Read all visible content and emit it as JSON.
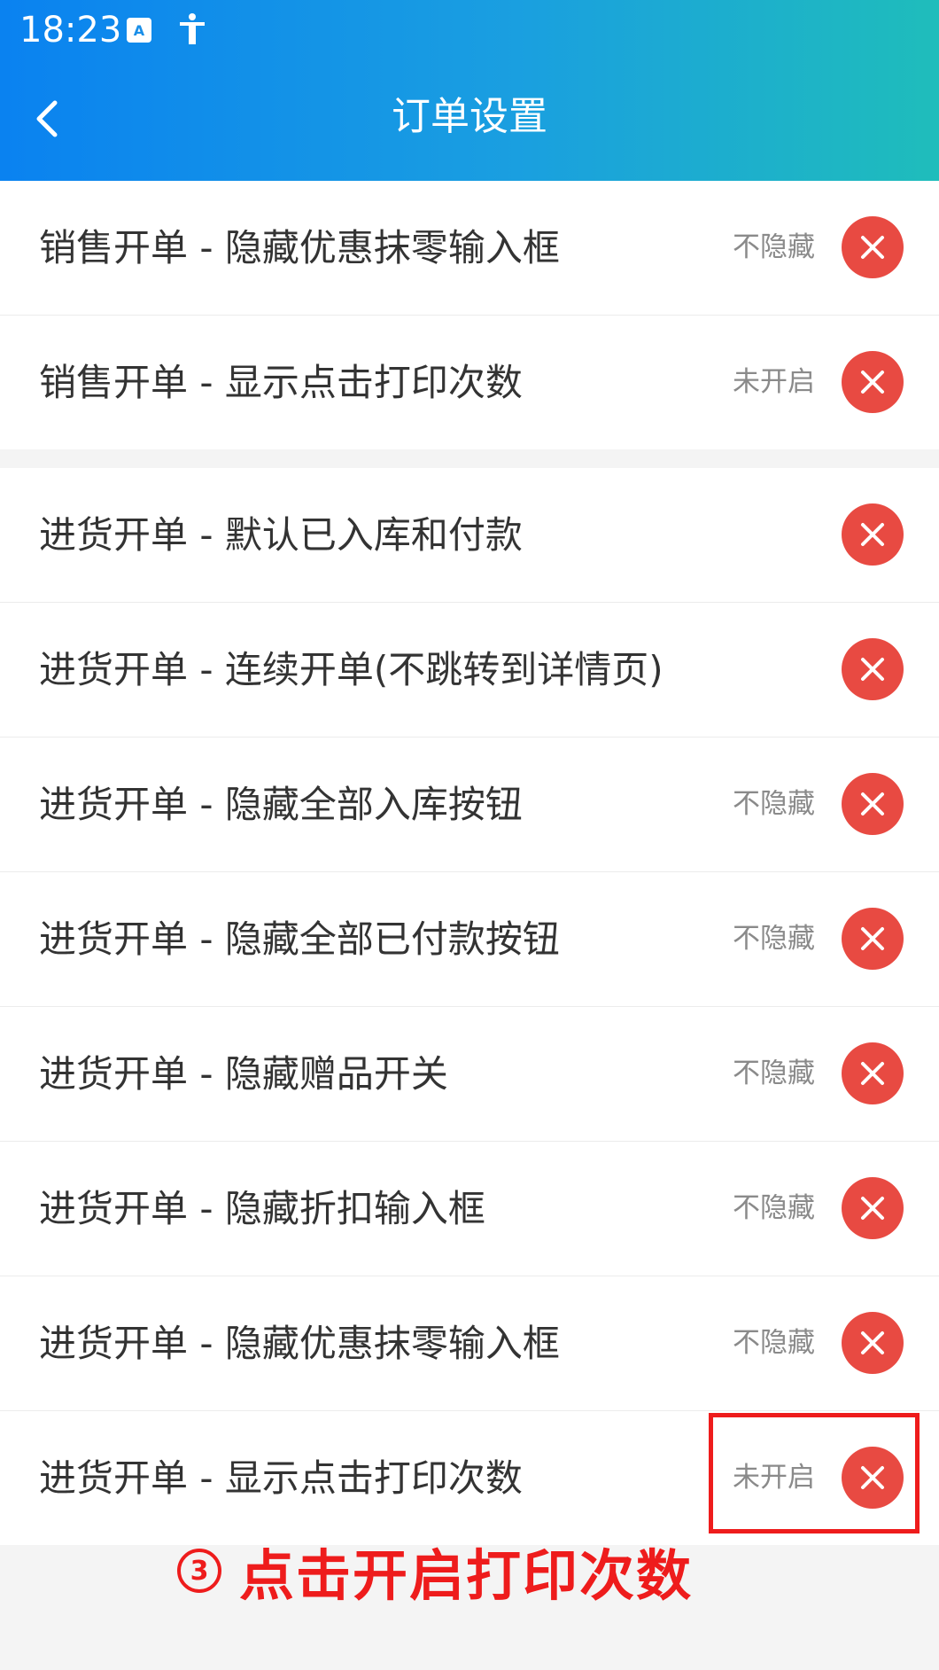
{
  "status_bar": {
    "time": "18:23"
  },
  "header": {
    "title": "订单设置"
  },
  "groups": [
    {
      "items": [
        {
          "label": "销售开单 - 隐藏优惠抹零输入框",
          "status": "不隐藏"
        },
        {
          "label": "销售开单 - 显示点击打印次数",
          "status": "未开启"
        }
      ]
    },
    {
      "items": [
        {
          "label": "进货开单 - 默认已入库和付款",
          "status": ""
        },
        {
          "label": "进货开单 - 连续开单(不跳转到详情页)",
          "status": ""
        },
        {
          "label": "进货开单 - 隐藏全部入库按钮",
          "status": "不隐藏"
        },
        {
          "label": "进货开单 - 隐藏全部已付款按钮",
          "status": "不隐藏"
        },
        {
          "label": "进货开单 - 隐藏赠品开关",
          "status": "不隐藏"
        },
        {
          "label": "进货开单 - 隐藏折扣输入框",
          "status": "不隐藏"
        },
        {
          "label": "进货开单 - 隐藏优惠抹零输入框",
          "status": "不隐藏"
        },
        {
          "label": "进货开单 - 显示点击打印次数",
          "status": "未开启"
        }
      ]
    }
  ],
  "annotation": {
    "number": "3",
    "text": "点击开启打印次数"
  },
  "colors": {
    "accent_red": "#e84a42",
    "annotation_red": "#ee1c1c",
    "header_start": "#0a82f0",
    "header_end": "#1fbdbb"
  }
}
